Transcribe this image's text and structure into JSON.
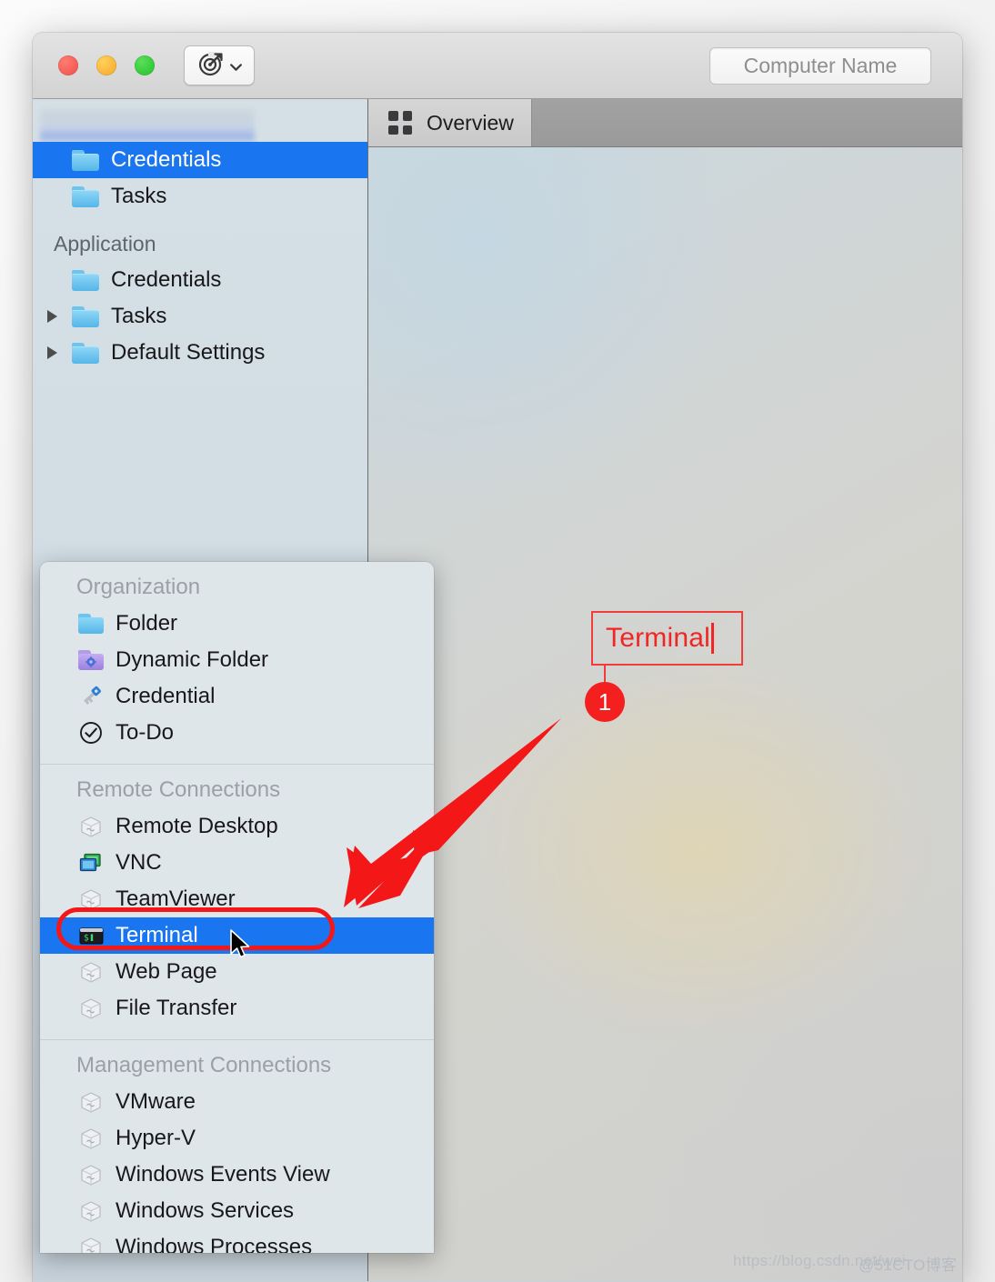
{
  "window": {
    "titlebar": {
      "traffic_lights": [
        {
          "name": "close",
          "color": "#ee4f48"
        },
        {
          "name": "minimize",
          "color": "#f5a623"
        },
        {
          "name": "zoom",
          "color": "#23c128"
        }
      ],
      "toolbar_button": {
        "icon": "target-arrow-icon",
        "dropdown_icon": "chevron-down-icon"
      },
      "search": {
        "placeholder": "Computer Name",
        "value": ""
      }
    }
  },
  "sidebar": {
    "redacted_item": {
      "label": ""
    },
    "items": [
      {
        "label": "Credentials",
        "icon": "folder-icon",
        "selected": true,
        "disclosure": false
      },
      {
        "label": "Tasks",
        "icon": "folder-icon",
        "selected": false,
        "disclosure": false
      }
    ],
    "group_label": "Application",
    "group_items": [
      {
        "label": "Credentials",
        "icon": "folder-icon",
        "selected": false,
        "disclosure": false
      },
      {
        "label": "Tasks",
        "icon": "folder-icon",
        "selected": false,
        "disclosure": true
      },
      {
        "label": "Default Settings",
        "icon": "folder-icon",
        "selected": false,
        "disclosure": true
      }
    ]
  },
  "main": {
    "tabs": [
      {
        "label": "Overview",
        "icon": "grid-icon",
        "active": true
      }
    ]
  },
  "context_menu": {
    "sections": [
      {
        "header": "Organization",
        "items": [
          {
            "label": "Folder",
            "icon": "folder-icon",
            "selected": false
          },
          {
            "label": "Dynamic Folder",
            "icon": "dynamic-folder-icon",
            "selected": false
          },
          {
            "label": "Credential",
            "icon": "key-icon",
            "selected": false
          },
          {
            "label": "To-Do",
            "icon": "check-circle-icon",
            "selected": false
          }
        ]
      },
      {
        "header": "Remote Connections",
        "items": [
          {
            "label": "Remote Desktop",
            "icon": "cube-icon",
            "selected": false
          },
          {
            "label": "VNC",
            "icon": "vnc-icon",
            "selected": false
          },
          {
            "label": "TeamViewer",
            "icon": "cube-icon",
            "selected": false
          },
          {
            "label": "Terminal",
            "icon": "terminal-icon",
            "selected": true
          },
          {
            "label": "Web Page",
            "icon": "cube-icon",
            "selected": false
          },
          {
            "label": "File Transfer",
            "icon": "cube-icon",
            "selected": false
          }
        ]
      },
      {
        "header": "Management Connections",
        "items": [
          {
            "label": "VMware",
            "icon": "cube-icon",
            "selected": false
          },
          {
            "label": "Hyper-V",
            "icon": "cube-icon",
            "selected": false
          },
          {
            "label": "Windows Events View",
            "icon": "cube-icon",
            "selected": false
          },
          {
            "label": "Windows Services",
            "icon": "cube-icon",
            "selected": false
          },
          {
            "label": "Windows Processes",
            "icon": "cube-icon",
            "selected": false
          }
        ]
      }
    ]
  },
  "annotations": {
    "callout_text": "Terminal",
    "badge_number": "1",
    "color": "#f41f1f"
  },
  "watermark": {
    "text_left": "https://blog.csdn.net/wei",
    "text_right": "@51CTO博客"
  }
}
